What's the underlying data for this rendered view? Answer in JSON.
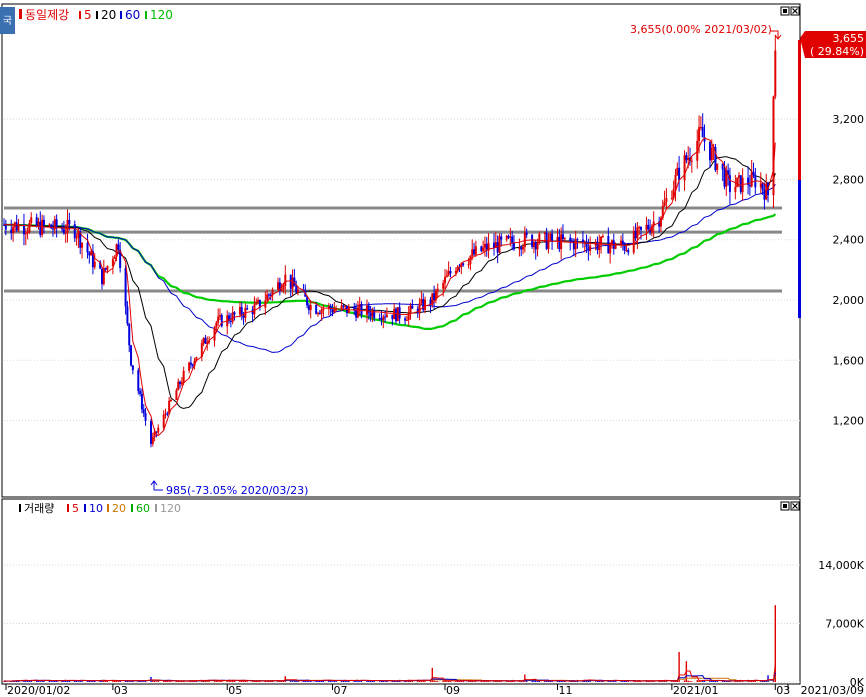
{
  "app": {
    "side_tab_label": "국",
    "price_legend": [
      {
        "text": "동일제강",
        "color": "#e00000"
      },
      {
        "text": "5",
        "color": "#e00000"
      },
      {
        "text": "20",
        "color": "#000000"
      },
      {
        "text": "60",
        "color": "#0000cc"
      },
      {
        "text": "120",
        "color": "#00bb00"
      }
    ],
    "volume_legend": [
      {
        "text": "거래량",
        "color": "#000000"
      },
      {
        "text": "5",
        "color": "#e00000"
      },
      {
        "text": "10",
        "color": "#0000cc"
      },
      {
        "text": "20",
        "color": "#cc7700"
      },
      {
        "text": "60",
        "color": "#00aa00"
      },
      {
        "text": "120",
        "color": "#999999"
      }
    ],
    "current_price_box": {
      "price": "3,655",
      "change": "( 29.84%)"
    },
    "annotations": {
      "high": "3,655(0.00% 2021/03/02)",
      "low": "985(-73.05% 2020/03/23)"
    },
    "colors": {
      "up": "#e00000",
      "down": "#0000dd",
      "ma5": "#e00000",
      "ma20": "#000000",
      "ma60": "#0000cc",
      "ma120": "#00cc00",
      "support_lines": "#888888"
    }
  },
  "chart_data": [
    {
      "type": "candlestick",
      "title": "동일제강",
      "ylim": [
        700,
        3950
      ],
      "y_ticks": [
        1200,
        1600,
        2000,
        2400,
        2800,
        3200
      ],
      "y_tick_labels": [
        "1,200",
        "1,600",
        "2,000",
        "2,400",
        "2,800",
        "3,200"
      ],
      "x_tick_labels": [
        "2020/01/02",
        "03",
        "05",
        "07",
        "09",
        "11",
        "2021/01",
        "03"
      ],
      "horizontal_lines": [
        2610,
        2450,
        2060
      ],
      "ohlc_keypoints": [
        {
          "date": "2020/01/02",
          "close": 2500
        },
        {
          "date": "2020/02/10",
          "close": 2470
        },
        {
          "date": "2020/02/25",
          "close": 2150
        },
        {
          "date": "2020/03/05",
          "close": 2380
        },
        {
          "date": "2020/03/12",
          "close": 1600
        },
        {
          "date": "2020/03/23",
          "close": 1050,
          "low": 985
        },
        {
          "date": "2020/04/10",
          "close": 1500
        },
        {
          "date": "2020/04/28",
          "close": 1850
        },
        {
          "date": "2020/05/20",
          "close": 1950
        },
        {
          "date": "2020/06/05",
          "close": 2150
        },
        {
          "date": "2020/06/20",
          "close": 1950
        },
        {
          "date": "2020/07/15",
          "close": 1930
        },
        {
          "date": "2020/08/10",
          "close": 1900
        },
        {
          "date": "2020/08/25",
          "close": 2000
        },
        {
          "date": "2020/09/08",
          "close": 2250
        },
        {
          "date": "2020/09/25",
          "close": 2350
        },
        {
          "date": "2020/10/15",
          "close": 2400
        },
        {
          "date": "2020/11/10",
          "close": 2380
        },
        {
          "date": "2020/12/10",
          "close": 2360
        },
        {
          "date": "2020/12/28",
          "close": 2550
        },
        {
          "date": "2021/01/08",
          "close": 2850
        },
        {
          "date": "2021/01/20",
          "close": 3100
        },
        {
          "date": "2021/02/05",
          "close": 2750
        },
        {
          "date": "2021/02/20",
          "close": 2800
        },
        {
          "date": "2021/02/26",
          "close": 2700
        },
        {
          "date": "2021/03/02",
          "close": 3655,
          "high": 3655
        }
      ],
      "current_price": 3655,
      "current_change_pct": 29.84,
      "high": {
        "value": 3655,
        "pct": 0.0,
        "date": "2021/03/02"
      },
      "low": {
        "value": 985,
        "pct": -73.05,
        "date": "2020/03/23"
      }
    },
    {
      "type": "bar",
      "title": "거래량",
      "ylim": [
        0,
        20000
      ],
      "y_ticks": [
        0,
        7000,
        14000
      ],
      "y_tick_labels": [
        "0K",
        "7,000K",
        "14,000K"
      ],
      "x_tick_labels": [
        "2020/01/02",
        "03",
        "05",
        "07",
        "09",
        "11",
        "2021/01",
        "03",
        "2021/03/09"
      ],
      "notable_volumes": [
        {
          "date": "2020/03/23",
          "value": 600
        },
        {
          "date": "2020/06/05",
          "value": 700
        },
        {
          "date": "2020/08/25",
          "value": 1700
        },
        {
          "date": "2020/10/15",
          "value": 900
        },
        {
          "date": "2021/01/08",
          "value": 3600
        },
        {
          "date": "2021/01/12",
          "value": 2500
        },
        {
          "date": "2021/02/26",
          "value": 800
        },
        {
          "date": "2021/03/02",
          "value": 18500
        },
        {
          "date": "2021/03/03",
          "value": 9200
        }
      ]
    }
  ]
}
